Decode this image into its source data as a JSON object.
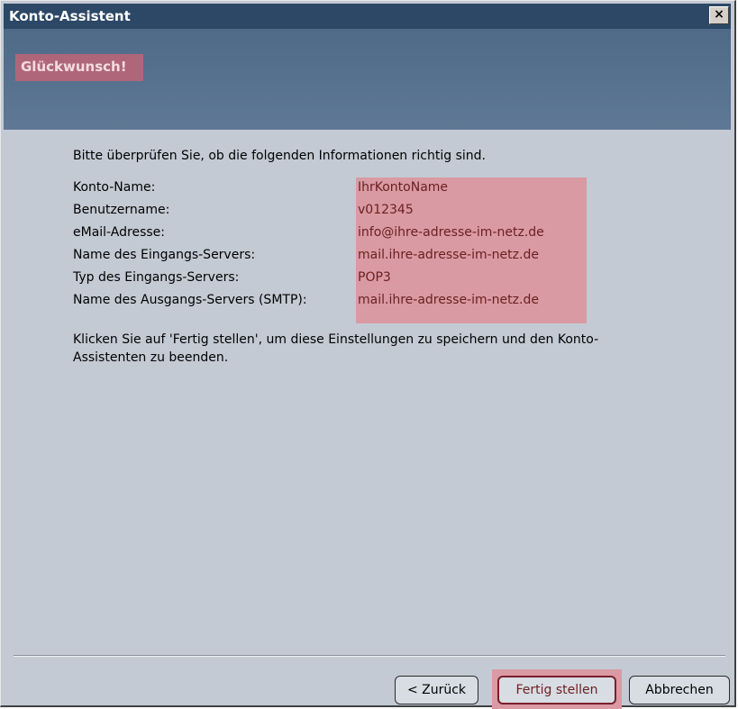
{
  "window": {
    "title": "Konto-Assistent",
    "close_label": "×"
  },
  "header": {
    "title": "Glückwunsch!"
  },
  "content": {
    "intro": "Bitte überprüfen Sie, ob die folgenden Informationen richtig sind.",
    "fields": [
      {
        "label": "Konto-Name:",
        "value": "IhrKontoName"
      },
      {
        "label": "Benutzername:",
        "value": "v012345"
      },
      {
        "label": "eMail-Adresse:",
        "value": "info@ihre-adresse-im-netz.de"
      },
      {
        "label": "Name des Eingangs-Servers:",
        "value": "mail.ihre-adresse-im-netz.de"
      },
      {
        "label": "Typ des Eingangs-Servers:",
        "value": "POP3"
      },
      {
        "label": "Name des Ausgangs-Servers (SMTP):",
        "value": "mail.ihre-adresse-im-netz.de"
      }
    ],
    "finish_hint": "Klicken Sie auf 'Fertig stellen', um diese Einstellungen zu speichern und den Konto-Assistenten zu beenden."
  },
  "buttons": {
    "back": "< Zurück",
    "finish": "Fertig stellen",
    "cancel": "Abbrechen"
  },
  "colors": {
    "titlebar": "#2c4866",
    "header_band": "#5a7491",
    "dialog_bg": "#c4cad4",
    "highlight": "#d99aa3"
  }
}
